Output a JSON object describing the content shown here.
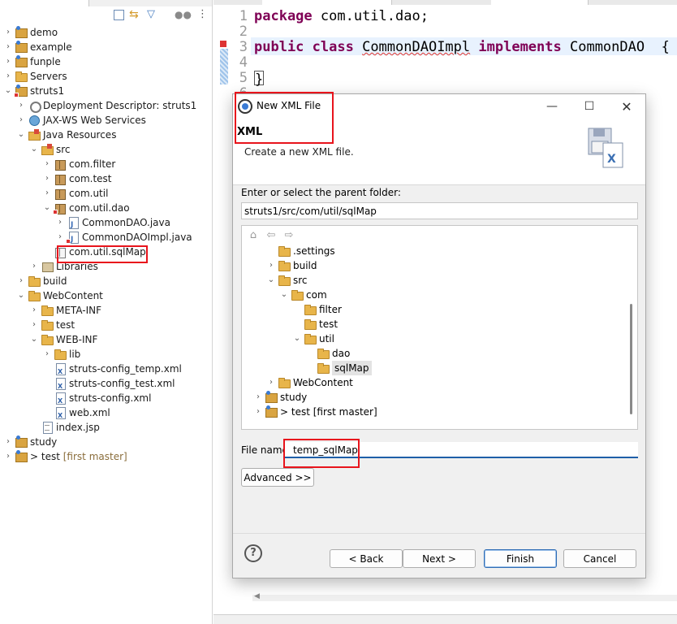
{
  "explorer": {
    "items": [
      {
        "label": "demo"
      },
      {
        "label": "example"
      },
      {
        "label": "funple"
      },
      {
        "label": "Servers"
      },
      {
        "label": "struts1"
      },
      {
        "label": "Deployment Descriptor: struts1"
      },
      {
        "label": "JAX-WS Web Services"
      },
      {
        "label": "Java Resources"
      },
      {
        "label": "src"
      },
      {
        "label": "com.filter"
      },
      {
        "label": "com.test"
      },
      {
        "label": "com.util"
      },
      {
        "label": "com.util.dao"
      },
      {
        "label": "CommonDAO.java"
      },
      {
        "label": "CommonDAOImpl.java"
      },
      {
        "label": "com.util.sqlMap"
      },
      {
        "label": "Libraries"
      },
      {
        "label": "build"
      },
      {
        "label": "WebContent"
      },
      {
        "label": "META-INF"
      },
      {
        "label": "test"
      },
      {
        "label": "WEB-INF"
      },
      {
        "label": "lib"
      },
      {
        "label": "struts-config_temp.xml"
      },
      {
        "label": "struts-config_test.xml"
      },
      {
        "label": "struts-config.xml"
      },
      {
        "label": "web.xml"
      },
      {
        "label": "index.jsp"
      },
      {
        "label": "study"
      },
      {
        "label": "> test",
        "suffix": "[first master]"
      }
    ]
  },
  "editor": {
    "lines": [
      {
        "no": "1",
        "kw": "package",
        "text": " com.util.dao;"
      },
      {
        "no": "2"
      },
      {
        "no": "3",
        "kw": "public class",
        "cls": "CommonDAOImpl",
        "kw2": "implements",
        "text": " CommonDAO  {"
      },
      {
        "no": "4"
      },
      {
        "no": "5",
        "text": "}"
      },
      {
        "no": "6"
      }
    ]
  },
  "dialog": {
    "title": "New XML File",
    "header_title": "XML",
    "header_desc": "Create a new XML file.",
    "parent_label": "Enter or select the parent folder:",
    "parent_value": "struts1/src/com/util/sqlMap",
    "folder_tree": [
      {
        "label": ".settings"
      },
      {
        "label": "build"
      },
      {
        "label": "src"
      },
      {
        "label": "com"
      },
      {
        "label": "filter"
      },
      {
        "label": "test"
      },
      {
        "label": "util"
      },
      {
        "label": "dao"
      },
      {
        "label": "sqlMap"
      },
      {
        "label": "WebContent"
      },
      {
        "label": "study"
      },
      {
        "label": "> test [first master]"
      }
    ],
    "filename_label": "File name:",
    "filename_value": "temp_sqlMap",
    "advanced_label": "Advanced >>",
    "back_label": "< Back",
    "next_label": "Next >",
    "finish_label": "Finish",
    "cancel_label": "Cancel",
    "help_glyph": "?"
  },
  "colors": {
    "highlight": "#e8141c",
    "keyword": "#7f0055",
    "accent": "#1f5fa8"
  }
}
